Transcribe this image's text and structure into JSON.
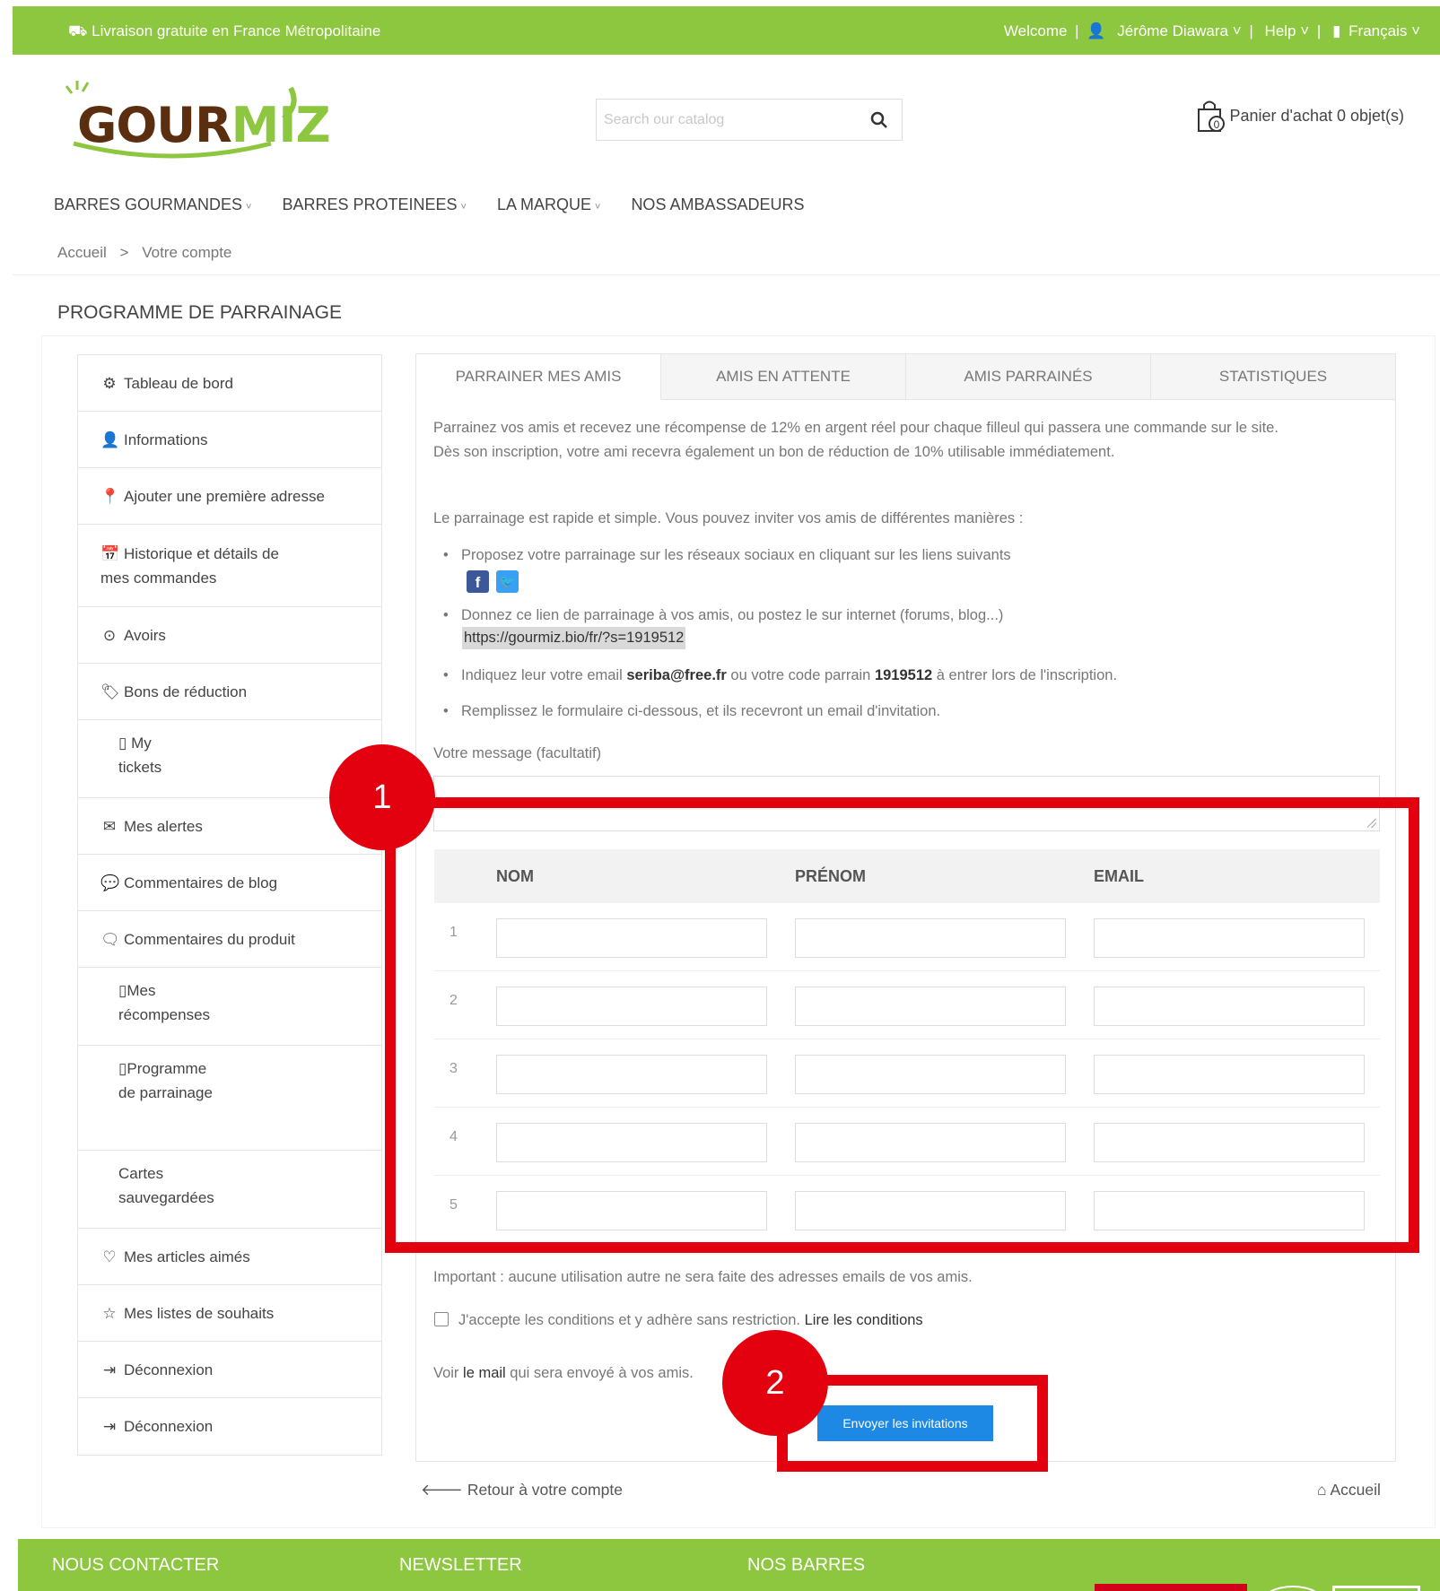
{
  "topbar": {
    "shipping": "Livraison gratuite en France Métropolitaine",
    "welcome": "Welcome",
    "user": "Jérôme Diawara",
    "help": "Help",
    "language": "Français"
  },
  "header": {
    "logo_text_1": "GOUR",
    "logo_text_2": "MIZ",
    "search_placeholder": "Search our catalog",
    "cart": "Panier d'achat 0 objet(s)"
  },
  "nav": [
    "BARRES GOURMANDES",
    "BARRES PROTEINEES",
    "LA MARQUE",
    "NOS AMBASSADEURS"
  ],
  "breadcrumb": {
    "home": "Accueil",
    "sep": ">",
    "current": "Votre compte"
  },
  "page_title": "PROGRAMME DE PARRAINAGE",
  "sidebar": [
    {
      "label": "Tableau de bord"
    },
    {
      "label": "Informations"
    },
    {
      "label": "Ajouter une première adresse"
    },
    {
      "label": "Historique et détails de mes commandes"
    },
    {
      "label": "Avoirs"
    },
    {
      "label": "Bons de réduction"
    },
    {
      "label": "My tickets"
    },
    {
      "label": "Mes alertes"
    },
    {
      "label": "Commentaires de blog"
    },
    {
      "label": "Commentaires du produit"
    },
    {
      "label": "Mes récompenses"
    },
    {
      "label": "Programme de parrainage"
    },
    {
      "label": "Cartes sauvegardées"
    },
    {
      "label": "Mes articles aimés"
    },
    {
      "label": "Mes listes de souhaits"
    },
    {
      "label": "Déconnexion"
    },
    {
      "label": "Déconnexion"
    }
  ],
  "tabs": [
    "PARRAINER MES AMIS",
    "AMIS EN ATTENTE",
    "AMIS PARRAINÉS",
    "STATISTIQUES"
  ],
  "intro_1": "Parrainez vos amis et recevez une récompense de 12% en argent réel pour chaque filleul qui passera une commande sur le site.",
  "intro_2": "Dès son inscription, votre ami recevra également un bon de réduction de 10% utilisable immédiatement.",
  "ways": "Le parrainage est rapide et simple. Vous pouvez inviter vos amis de différentes manières :",
  "bullet_1": "Proposez votre parrainage sur les réseaux sociaux en cliquant sur les liens suivants",
  "bullet_2": "Donnez ce lien de parrainage à vos amis, ou postez le sur internet (forums, blog...)",
  "ref_link": "https://gourmiz.bio/fr/?s=1919512",
  "bullet_3_a": "Indiquez leur votre email ",
  "bullet_3_email": "seriba@free.fr",
  "bullet_3_b": " ou votre code parrain ",
  "bullet_3_code": "1919512",
  "bullet_3_c": " à entrer lors de l'inscription.",
  "bullet_4": "Remplissez le formulaire ci-dessous, et ils recevront un email d'invitation.",
  "message_label": "Votre message (facultatif)",
  "table": {
    "headers": [
      "NOM",
      "PRÉNOM",
      "EMAIL"
    ],
    "rows": [
      "1",
      "2",
      "3",
      "4",
      "5"
    ]
  },
  "important": "Important : aucune utilisation autre ne sera faite des adresses emails de vos amis.",
  "accept": "J'accepte les conditions et y adhère sans restriction.",
  "accept_link": "Lire les conditions",
  "see_mail_a": "Voir ",
  "see_mail_link": "le mail",
  "see_mail_b": " qui sera envoyé à vos amis.",
  "send_button": "Envoyer les invitations",
  "back": "Retour à votre compte",
  "home": "Accueil",
  "annotations": [
    "1",
    "2"
  ],
  "footer": [
    "NOUS CONTACTER",
    "NEWSLETTER",
    "NOS BARRES"
  ],
  "colors": {
    "brand_green": "#8dc63f",
    "annotation_red": "#e3000f",
    "button_blue": "#1e88e5"
  }
}
